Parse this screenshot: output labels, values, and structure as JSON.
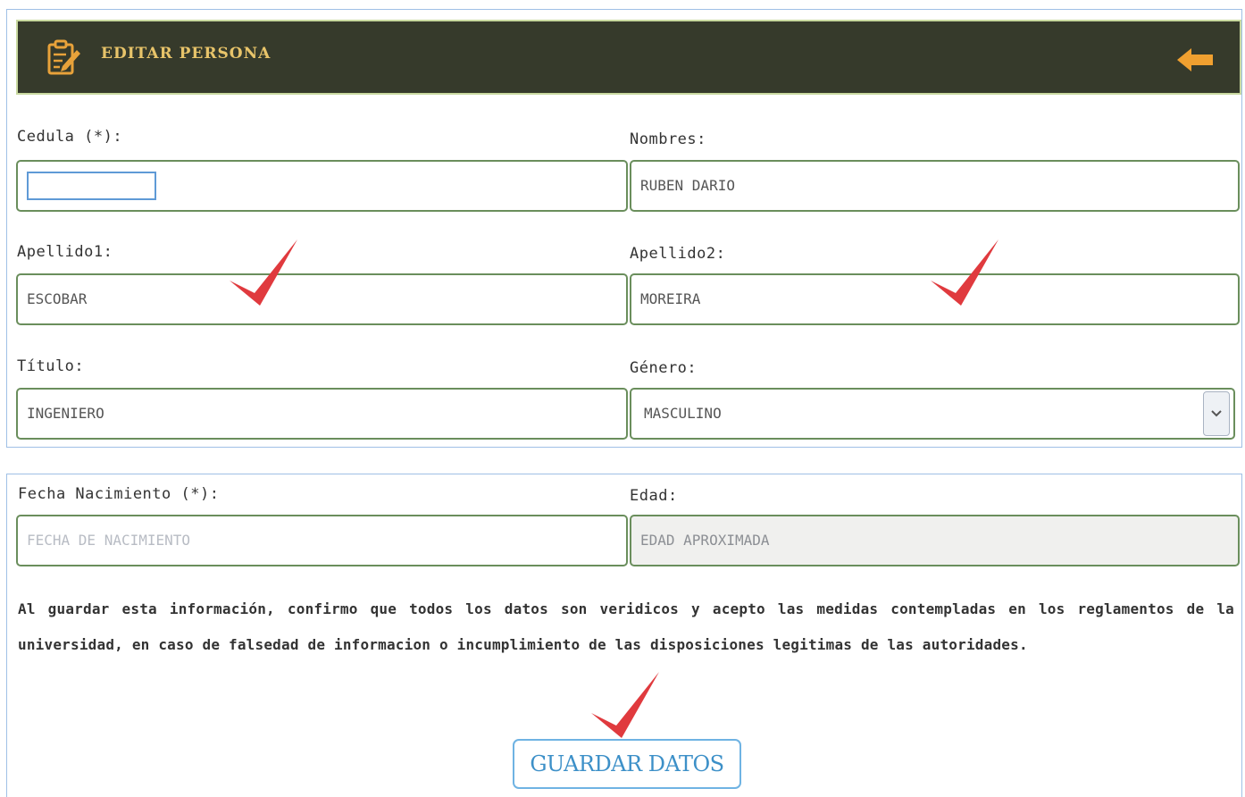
{
  "header": {
    "title": "EDITAR PERSONA",
    "icons": {
      "document": "edit-document-icon",
      "back": "arrow-left-icon"
    },
    "colors": {
      "background": "#363a2b",
      "title": "#e8c46a",
      "back_arrow": "#f0a030"
    }
  },
  "form": {
    "cedula": {
      "label": "Cedula (*):",
      "value": ""
    },
    "nombres": {
      "label": "Nombres:",
      "value": "RUBEN DARIO"
    },
    "apellido1": {
      "label": "Apellido1:",
      "value": "ESCOBAR"
    },
    "apellido2": {
      "label": "Apellido2:",
      "value": "MOREIRA"
    },
    "titulo": {
      "label": "Título:",
      "value": "INGENIERO"
    },
    "genero": {
      "label": "Género:",
      "selected": "MASCULINO"
    },
    "fecha_nacimiento": {
      "label": "Fecha Nacimiento (*):",
      "placeholder": "FECHA DE NACIMIENTO"
    },
    "edad": {
      "label": "Edad:",
      "placeholder": "EDAD APROXIMADA"
    }
  },
  "disclaimer": "Al guardar esta información, confirmo que todos los datos son veridicos y acepto las medidas contempladas en los reglamentos de la universidad, en caso de falsedad de informacion o incumplimiento de las disposiciones legitimas de las autoridades.",
  "actions": {
    "save_label": "GUARDAR DATOS"
  },
  "annotations": {
    "check_mark_color": "#e03a3e"
  }
}
